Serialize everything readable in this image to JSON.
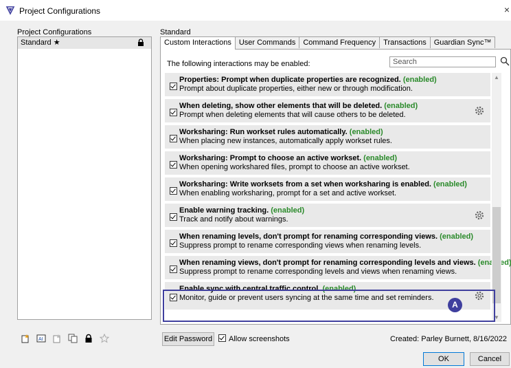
{
  "window": {
    "title": "Project Configurations",
    "close_glyph": "×"
  },
  "left": {
    "group_label": "Project Configurations",
    "items": [
      {
        "label": "Standard ★",
        "locked": true
      }
    ],
    "tool_icons": [
      "new-config-icon",
      "rename-config-icon",
      "duplicate-config-icon",
      "copy-config-icon",
      "lock-icon",
      "set-default-star-icon"
    ]
  },
  "right": {
    "group_label": "Standard",
    "tabs": [
      {
        "label": "Custom Interactions",
        "active": true
      },
      {
        "label": "User Commands"
      },
      {
        "label": "Command Frequency"
      },
      {
        "label": "Transactions"
      },
      {
        "label": "Guardian Sync™"
      }
    ],
    "intro": "The following interactions may be enabled:",
    "search_placeholder": "Search",
    "enabled_text": "(enabled)",
    "rows": [
      {
        "title": "Properties: Prompt when duplicate properties are recognized.",
        "desc": "Prompt about duplicate properties, either new or through modification.",
        "checked": true,
        "gear": false
      },
      {
        "title": "When deleting, show other elements that will be deleted.",
        "desc": "Prompt when deleting elements that will cause others to be deleted.",
        "checked": true,
        "gear": true
      },
      {
        "title": "Worksharing: Run workset rules automatically.",
        "desc": "When placing new instances, automatically apply workset rules.",
        "checked": true,
        "gear": false
      },
      {
        "title": "Worksharing: Prompt to choose an active workset.",
        "desc": "When opening workshared files, prompt to choose an active workset.",
        "checked": true,
        "gear": false
      },
      {
        "title": "Worksharing: Write worksets from a set when worksharing is enabled.",
        "desc": "When enabling worksharing, prompt for a set and active workset.",
        "checked": true,
        "gear": false
      },
      {
        "title": "Enable warning tracking.",
        "desc": "Track and notify about warnings.",
        "checked": true,
        "gear": true
      },
      {
        "title": "When renaming levels, don't prompt for renaming corresponding views.",
        "desc": "Suppress prompt to rename corresponding views when renaming levels.",
        "checked": true,
        "gear": false
      },
      {
        "title": "When renaming views, don't prompt for renaming corresponding levels and views.",
        "desc": "Suppress prompt to rename corresponding levels and views when renaming views.",
        "checked": true,
        "gear": false
      },
      {
        "title": "Enable sync with central traffic control.",
        "desc": "Monitor, guide or prevent users syncing at the same time and set reminders.",
        "checked": true,
        "gear": true
      }
    ],
    "edit_password": "Edit Password",
    "allow_screenshots": "Allow screenshots",
    "created": "Created: Parley Burnett, 8/16/2022"
  },
  "callout": {
    "label": "A",
    "color": "#3f3f9e"
  },
  "footer": {
    "ok": "OK",
    "cancel": "Cancel"
  },
  "colors": {
    "enabled": "#2a8a2a",
    "accent": "#0078d7"
  }
}
